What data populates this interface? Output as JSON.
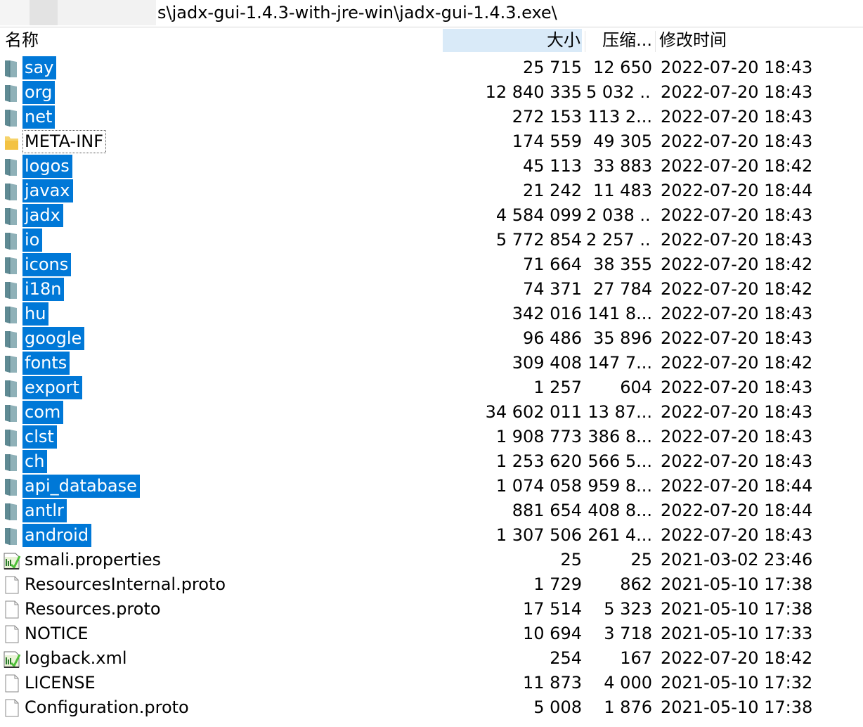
{
  "path_bar": {
    "text": "s\\jadx-gui-1.4.3-with-jre-win\\jadx-gui-1.4.3.exe\\"
  },
  "columns": {
    "name": "名称",
    "size": "大小",
    "compressed": "压缩...",
    "modified": "修改时间"
  },
  "colors": {
    "selection": "#0078d7",
    "sorted_column": "#d9eaf8",
    "folder_teal": "#7a9ea6",
    "folder_yellow": "#f4c542"
  },
  "rows": [
    {
      "name": "say",
      "size": "25 715",
      "compressed": "12 650",
      "modified": "2022-07-20 18:43",
      "icon": "folder-icon",
      "selected": true
    },
    {
      "name": "org",
      "size": "12 840 335",
      "compressed": "5 032 ...",
      "modified": "2022-07-20 18:43",
      "icon": "folder-icon",
      "selected": true
    },
    {
      "name": "net",
      "size": "272 153",
      "compressed": "113 2...",
      "modified": "2022-07-20 18:43",
      "icon": "folder-icon",
      "selected": true
    },
    {
      "name": "META-INF",
      "size": "174 559",
      "compressed": "49 305",
      "modified": "2022-07-20 18:43",
      "icon": "folder-open-icon",
      "selected": false,
      "focused": true
    },
    {
      "name": "logos",
      "size": "45 113",
      "compressed": "33 883",
      "modified": "2022-07-20 18:42",
      "icon": "folder-icon",
      "selected": true
    },
    {
      "name": "javax",
      "size": "21 242",
      "compressed": "11 483",
      "modified": "2022-07-20 18:44",
      "icon": "folder-icon",
      "selected": true
    },
    {
      "name": "jadx",
      "size": "4 584 099",
      "compressed": "2 038 ...",
      "modified": "2022-07-20 18:43",
      "icon": "folder-icon",
      "selected": true
    },
    {
      "name": "io",
      "size": "5 772 854",
      "compressed": "2 257 ...",
      "modified": "2022-07-20 18:43",
      "icon": "folder-icon",
      "selected": true
    },
    {
      "name": "icons",
      "size": "71 664",
      "compressed": "38 355",
      "modified": "2022-07-20 18:42",
      "icon": "folder-icon",
      "selected": true
    },
    {
      "name": "i18n",
      "size": "74 371",
      "compressed": "27 784",
      "modified": "2022-07-20 18:42",
      "icon": "folder-icon",
      "selected": true
    },
    {
      "name": "hu",
      "size": "342 016",
      "compressed": "141 8...",
      "modified": "2022-07-20 18:43",
      "icon": "folder-icon",
      "selected": true
    },
    {
      "name": "google",
      "size": "96 486",
      "compressed": "35 896",
      "modified": "2022-07-20 18:43",
      "icon": "folder-icon",
      "selected": true
    },
    {
      "name": "fonts",
      "size": "309 408",
      "compressed": "147 7...",
      "modified": "2022-07-20 18:42",
      "icon": "folder-icon",
      "selected": true
    },
    {
      "name": "export",
      "size": "1 257",
      "compressed": "604",
      "modified": "2022-07-20 18:43",
      "icon": "folder-icon",
      "selected": true
    },
    {
      "name": "com",
      "size": "34 602 011",
      "compressed": "13 87...",
      "modified": "2022-07-20 18:43",
      "icon": "folder-icon",
      "selected": true
    },
    {
      "name": "clst",
      "size": "1 908 773",
      "compressed": "386 8...",
      "modified": "2022-07-20 18:43",
      "icon": "folder-icon",
      "selected": true
    },
    {
      "name": "ch",
      "size": "1 253 620",
      "compressed": "566 5...",
      "modified": "2022-07-20 18:43",
      "icon": "folder-icon",
      "selected": true
    },
    {
      "name": "api_database",
      "size": "1 074 058",
      "compressed": "959 8...",
      "modified": "2022-07-20 18:44",
      "icon": "folder-icon",
      "selected": true
    },
    {
      "name": "antlr",
      "size": "881 654",
      "compressed": "408 8...",
      "modified": "2022-07-20 18:44",
      "icon": "folder-icon",
      "selected": true
    },
    {
      "name": "android",
      "size": "1 307 506",
      "compressed": "261 4...",
      "modified": "2022-07-20 18:43",
      "icon": "folder-icon",
      "selected": true
    },
    {
      "name": "smali.properties",
      "size": "25",
      "compressed": "25",
      "modified": "2021-03-02 23:46",
      "icon": "properties-file-icon",
      "selected": false
    },
    {
      "name": "ResourcesInternal.proto",
      "size": "1 729",
      "compressed": "862",
      "modified": "2021-05-10 17:38",
      "icon": "blank-file-icon",
      "selected": false
    },
    {
      "name": "Resources.proto",
      "size": "17 514",
      "compressed": "5 323",
      "modified": "2021-05-10 17:38",
      "icon": "blank-file-icon",
      "selected": false
    },
    {
      "name": "NOTICE",
      "size": "10 694",
      "compressed": "3 718",
      "modified": "2021-05-10 17:33",
      "icon": "blank-file-icon",
      "selected": false
    },
    {
      "name": "logback.xml",
      "size": "254",
      "compressed": "167",
      "modified": "2022-07-20 18:42",
      "icon": "properties-file-icon",
      "selected": false
    },
    {
      "name": "LICENSE",
      "size": "11 873",
      "compressed": "4 000",
      "modified": "2021-05-10 17:32",
      "icon": "blank-file-icon",
      "selected": false
    },
    {
      "name": "Configuration.proto",
      "size": "5 008",
      "compressed": "1 876",
      "modified": "2021-05-10 17:38",
      "icon": "blank-file-icon",
      "selected": false
    }
  ]
}
